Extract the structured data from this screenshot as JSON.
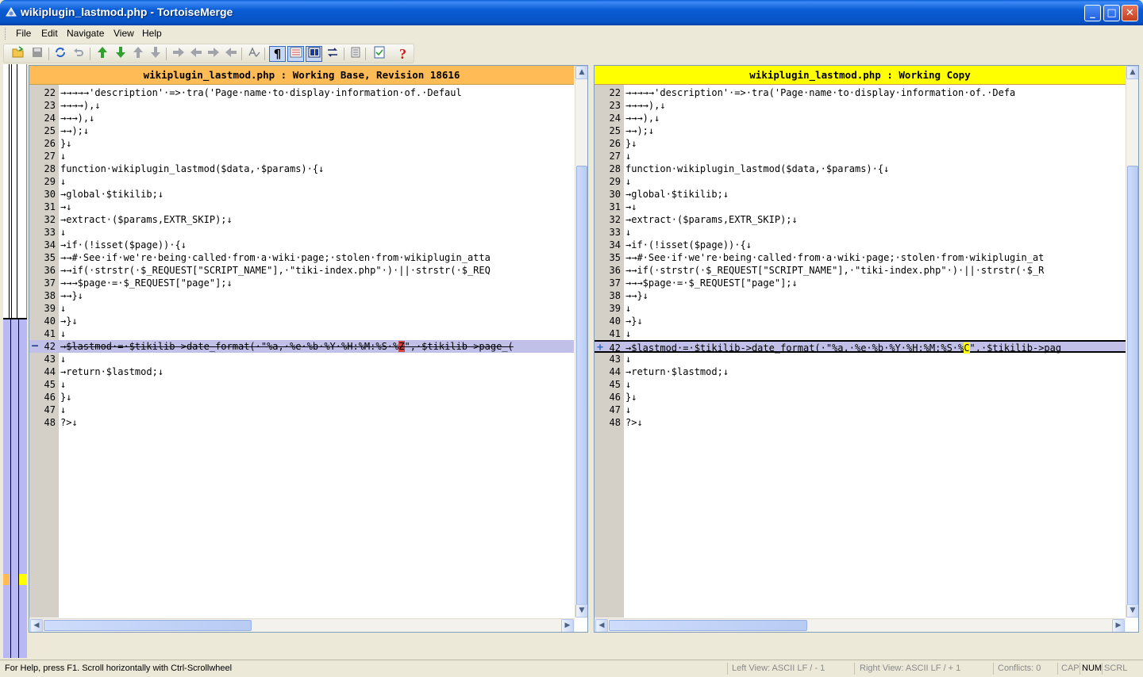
{
  "window": {
    "title": "wikiplugin_lastmod.php - TortoiseMerge",
    "minimize_glyph": "_",
    "maximize_glyph": "□",
    "close_glyph": "✕"
  },
  "menu": [
    "File",
    "Edit",
    "Navigate",
    "View",
    "Help"
  ],
  "toolbar": {
    "icons": [
      "open-icon",
      "save-icon",
      "reload-icon",
      "undo-icon",
      "next-difference-icon",
      "previous-difference-icon",
      "first-difference-icon",
      "last-difference-icon",
      "next-conflict-icon",
      "previous-conflict-icon",
      "next-inline-diff-icon",
      "previous-inline-diff-icon",
      "spellcheck-icon",
      "whitespace-icon",
      "inline-diff-icon",
      "one-pane-view-icon",
      "swap-views-icon",
      "settings-icon",
      "patch-list-icon",
      "help-icon"
    ]
  },
  "left_pane": {
    "header": "wikiplugin_lastmod.php : Working Base, Revision 18616",
    "header_color": "#ffbb55"
  },
  "right_pane": {
    "header": "wikiplugin_lastmod.php : Working Copy",
    "header_color": "#ffff00"
  },
  "changed_line": 42,
  "lines": [
    {
      "n": "22",
      "left": "→→→→→'description'·=>·tra('Page·name·to·display·information·of.·Defaul",
      "right": "→→→→→'description'·=>·tra('Page·name·to·display·information·of.·Defa"
    },
    {
      "n": "23",
      "left": "→→→→),↓",
      "right": "→→→→),↓"
    },
    {
      "n": "24",
      "left": "→→→),↓",
      "right": "→→→),↓"
    },
    {
      "n": "25",
      "left": "→→);↓",
      "right": "→→);↓"
    },
    {
      "n": "26",
      "left": "}↓",
      "right": "}↓"
    },
    {
      "n": "27",
      "left": "↓",
      "right": "↓"
    },
    {
      "n": "28",
      "left": "function·wikiplugin_lastmod($data,·$params)·{↓",
      "right": "function·wikiplugin_lastmod($data,·$params)·{↓"
    },
    {
      "n": "29",
      "left": "↓",
      "right": "↓"
    },
    {
      "n": "30",
      "left": "→global·$tikilib;↓",
      "right": "→global·$tikilib;↓"
    },
    {
      "n": "31",
      "left": "→↓",
      "right": "→↓"
    },
    {
      "n": "32",
      "left": "→extract·($params,EXTR_SKIP);↓",
      "right": "→extract·($params,EXTR_SKIP);↓"
    },
    {
      "n": "33",
      "left": "↓",
      "right": "↓"
    },
    {
      "n": "34",
      "left": "→if·(!isset($page))·{↓",
      "right": "→if·(!isset($page))·{↓"
    },
    {
      "n": "35",
      "left": "→→#·See·if·we're·being·called·from·a·wiki·page;·stolen·from·wikiplugin_atta",
      "right": "→→#·See·if·we're·being·called·from·a·wiki·page;·stolen·from·wikiplugin_at"
    },
    {
      "n": "36",
      "left": "→→if(·strstr(·$_REQUEST[\"SCRIPT_NAME\"],·\"tiki-index.php\"·)·||·strstr(·$_REQ",
      "right": "→→if(·strstr(·$_REQUEST[\"SCRIPT_NAME\"],·\"tiki-index.php\"·)·||·strstr(·$_R"
    },
    {
      "n": "37",
      "left": "→→→$page·=·$_REQUEST[\"page\"];↓",
      "right": "→→→$page·=·$_REQUEST[\"page\"];↓"
    },
    {
      "n": "38",
      "left": "→→}↓",
      "right": "→→}↓"
    },
    {
      "n": "39",
      "left": "↓",
      "right": "↓"
    },
    {
      "n": "40",
      "left": "→}↓",
      "right": "→}↓"
    },
    {
      "n": "41",
      "left": "↓",
      "right": "↓"
    },
    {
      "n": "42",
      "left_pre": "→$lastmod·=·$tikilib->date_format(·\"%a,·%e·%b·%Y·%H:%M:%S·%",
      "left_hl": "Z",
      "left_post": "\",·$tikilib->page_(",
      "right_pre": "→$lastmod·=·$tikilib->date_format(·\"%a,·%e·%b·%Y·%H:%M:%S·%",
      "right_hl": "C",
      "right_post": "\",·$tikilib->pag"
    },
    {
      "n": "43",
      "left": "↓",
      "right": "↓"
    },
    {
      "n": "44",
      "left": "→return·$lastmod;↓",
      "right": "→return·$lastmod;↓"
    },
    {
      "n": "45",
      "left": "↓",
      "right": "↓"
    },
    {
      "n": "46",
      "left": "}↓",
      "right": "}↓"
    },
    {
      "n": "47",
      "left": "↓",
      "right": "↓"
    },
    {
      "n": "48",
      "left": "?>↓",
      "right": "?>↓"
    }
  ],
  "left_marker": "—",
  "right_marker": "+",
  "status": {
    "help": "For Help, press F1. Scroll horizontally with Ctrl-Scrollwheel",
    "left_view": "Left View: ASCII LF / - 1",
    "right_view": "Right View: ASCII LF / + 1",
    "conflicts": "Conflicts: 0",
    "cap": "CAP",
    "num": "NUM",
    "scrl": "SCRL"
  }
}
